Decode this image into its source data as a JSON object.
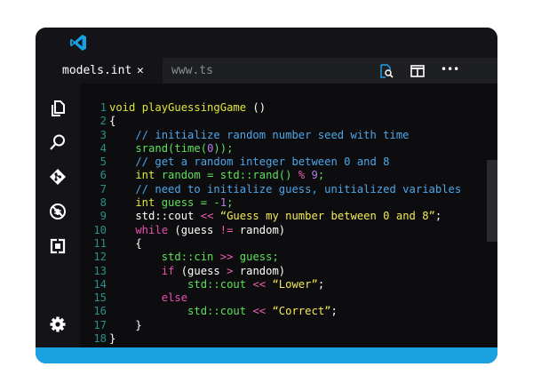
{
  "tabs": [
    {
      "label": "models.int",
      "close": "✕"
    },
    {
      "label": "www.ts"
    }
  ],
  "top_actions": [
    "search-file-icon",
    "split-editor-icon",
    "more-actions-icon"
  ],
  "more_label": "•••",
  "activity_icons": [
    "files-icon",
    "search-icon",
    "source-control-icon",
    "debug-icon",
    "extensions-icon",
    "settings-icon"
  ],
  "colors": {
    "accent": "#1aa1e2",
    "background": "#141418",
    "editor": "#0d0d10"
  },
  "code_lines": [
    {
      "n": "1",
      "tokens": [
        {
          "t": "void ",
          "c": "kw"
        },
        {
          "t": "playGuessingGame",
          "c": "fn"
        },
        {
          "t": " ()",
          "c": "w"
        }
      ]
    },
    {
      "n": "2",
      "tokens": [
        {
          "t": "{",
          "c": "w"
        }
      ]
    },
    {
      "n": "3",
      "tokens": [
        {
          "t": "    // initialize random number seed with time",
          "c": "cm"
        }
      ]
    },
    {
      "n": "4",
      "tokens": [
        {
          "t": "    srand(time(",
          "c": "ty"
        },
        {
          "t": "0",
          "c": "num"
        },
        {
          "t": "));",
          "c": "ty"
        }
      ]
    },
    {
      "n": "5",
      "tokens": [
        {
          "t": "    // get a random integer between 0 and 8",
          "c": "cm"
        }
      ]
    },
    {
      "n": "6",
      "tokens": [
        {
          "t": "    int ",
          "c": "kw"
        },
        {
          "t": "random = std::rand() ",
          "c": "ty"
        },
        {
          "t": "% ",
          "c": "op"
        },
        {
          "t": "9",
          "c": "num"
        },
        {
          "t": ";",
          "c": "ty"
        }
      ]
    },
    {
      "n": "7",
      "tokens": [
        {
          "t": "    // need to initialize guess, unitialized variables",
          "c": "cm"
        }
      ]
    },
    {
      "n": "8",
      "tokens": [
        {
          "t": "    int ",
          "c": "kw"
        },
        {
          "t": "guess = -",
          "c": "ty"
        },
        {
          "t": "1",
          "c": "num"
        },
        {
          "t": ";",
          "c": "ty"
        }
      ]
    },
    {
      "n": "9",
      "tokens": [
        {
          "t": "    std::cout ",
          "c": "w"
        },
        {
          "t": "<< ",
          "c": "op"
        },
        {
          "t": "“Guess my number between 0 and 8”",
          "c": "str"
        },
        {
          "t": ";",
          "c": "w"
        }
      ]
    },
    {
      "n": "10",
      "tokens": [
        {
          "t": "    while ",
          "c": "ctl"
        },
        {
          "t": "(guess ",
          "c": "w"
        },
        {
          "t": "!= ",
          "c": "op"
        },
        {
          "t": "random)",
          "c": "w"
        }
      ]
    },
    {
      "n": "11",
      "tokens": [
        {
          "t": "    {",
          "c": "w"
        }
      ]
    },
    {
      "n": "12",
      "tokens": [
        {
          "t": "        std::cin ",
          "c": "ty"
        },
        {
          "t": ">> ",
          "c": "op"
        },
        {
          "t": "guess;",
          "c": "ty"
        }
      ]
    },
    {
      "n": "13",
      "tokens": [
        {
          "t": "        if ",
          "c": "ctl"
        },
        {
          "t": "(guess ",
          "c": "w"
        },
        {
          "t": "> ",
          "c": "op"
        },
        {
          "t": "random)",
          "c": "w"
        }
      ]
    },
    {
      "n": "14",
      "tokens": [
        {
          "t": "            std::cout ",
          "c": "ty"
        },
        {
          "t": "<< ",
          "c": "op"
        },
        {
          "t": "“Lower”",
          "c": "str"
        },
        {
          "t": ";",
          "c": "w"
        }
      ]
    },
    {
      "n": "15",
      "tokens": [
        {
          "t": "        else",
          "c": "ctl"
        }
      ]
    },
    {
      "n": "16",
      "tokens": [
        {
          "t": "            std::cout ",
          "c": "ty"
        },
        {
          "t": "<< ",
          "c": "op"
        },
        {
          "t": "“Correct”",
          "c": "str"
        },
        {
          "t": ";",
          "c": "w"
        }
      ]
    },
    {
      "n": "17",
      "tokens": [
        {
          "t": "    }",
          "c": "w"
        }
      ]
    },
    {
      "n": "18",
      "tokens": [
        {
          "t": "}",
          "c": "w"
        }
      ]
    }
  ]
}
